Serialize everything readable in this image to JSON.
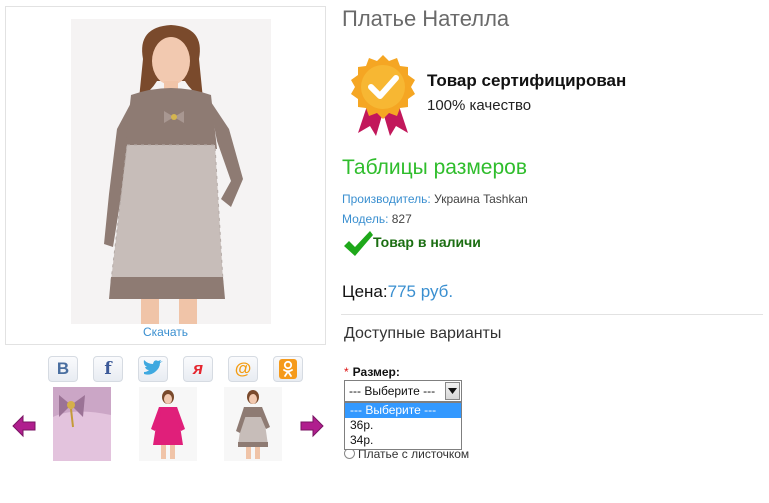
{
  "product": {
    "title": "Платье Нателла",
    "download_label": "Скачать"
  },
  "certificate": {
    "title": "Товар сертифицирован",
    "subtitle": "100% качество"
  },
  "size_table_link": "Таблицы размеров",
  "meta": {
    "manufacturer_label": "Производитель:",
    "manufacturer_value": "Украина Tashkan",
    "model_label": "Модель:",
    "model_value": "827"
  },
  "stock_status": "Товар в наличи",
  "price": {
    "label": "Цена:",
    "value": "775 руб."
  },
  "variants_heading": "Доступные варианты",
  "size": {
    "required_mark": "*",
    "label": "Размер:",
    "selected": "--- Выберите ---",
    "options": [
      "--- Выберите ---",
      "36р.",
      "34р."
    ]
  },
  "radio_partial_text": "Платье с листочком",
  "share_icons": [
    "vk-icon",
    "facebook-icon",
    "twitter-icon",
    "yaru-icon",
    "mailru-icon",
    "odnoklassniki-icon"
  ],
  "colors": {
    "accent_green": "#2fbd2c",
    "link_blue": "#3a8fd0",
    "stock_green": "#1b6e12",
    "selection_blue": "#3399ff",
    "arrow_magenta": "#b01e8e"
  }
}
